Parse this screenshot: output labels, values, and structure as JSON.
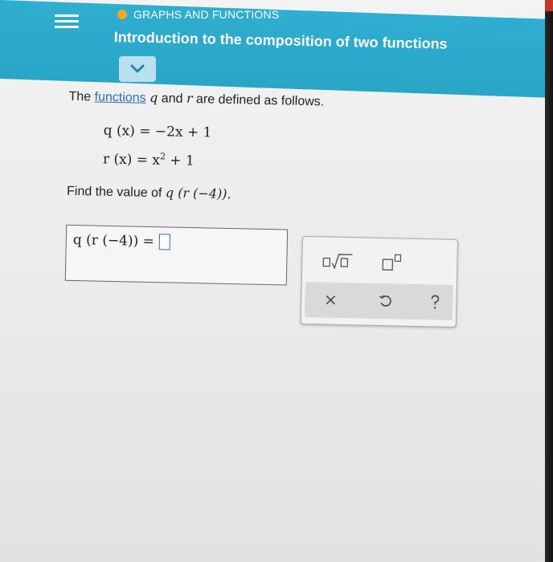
{
  "header": {
    "section": "GRAPHS AND FUNCTIONS",
    "topic": "Introduction to the composition of two functions"
  },
  "problem": {
    "intro_pre": "The ",
    "intro_link": "functions",
    "intro_mid": " and ",
    "intro_post": " are defined as follows.",
    "var_q": "q",
    "var_r": "r",
    "eq1": "q (x) = −2x + 1",
    "eq2_pre": "r (x) = x",
    "eq2_exp": "2",
    "eq2_post": " + 1",
    "question_pre": "Find the value of ",
    "question_math": "q (r (−4)).",
    "answer_expr": "q (r (−4)) ="
  },
  "colors": {
    "topbar": "#2eaed0",
    "accent_dot": "#f5a623",
    "link": "#2a6fb5"
  }
}
